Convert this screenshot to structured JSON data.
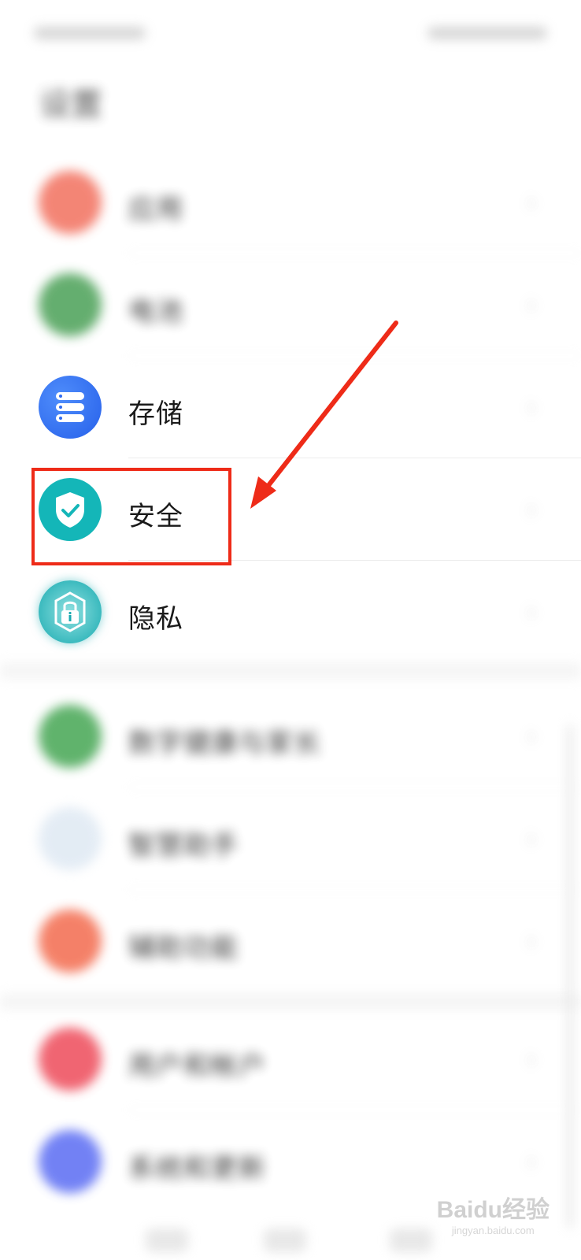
{
  "status_bar": {
    "left_text": "",
    "right_text": ""
  },
  "page": {
    "title": "设置"
  },
  "settings_items": [
    {
      "label": "应用",
      "icon": "apps-icon",
      "color": "#f2705e",
      "blurred": true
    },
    {
      "label": "电池",
      "icon": "battery-icon",
      "color": "#4aa056",
      "blurred": true
    },
    {
      "label": "存储",
      "icon": "storage-icon",
      "color": "#2f6bf0",
      "blurred": false
    },
    {
      "label": "安全",
      "icon": "shield-check-icon",
      "color": "#14b6b8",
      "blurred": false
    },
    {
      "label": "隐私",
      "icon": "lock-info-icon",
      "color": "#1fb3b5",
      "blurred": false
    },
    {
      "label": "数字健康与家长",
      "icon": "hourglass-icon",
      "color": "#45a653",
      "blurred": true
    },
    {
      "label": "智慧助手",
      "icon": "assistant-icon",
      "color": "#9cc0e0",
      "blurred": true
    },
    {
      "label": "辅助功能",
      "icon": "accessibility-icon",
      "color": "#f36b4e",
      "blurred": true
    },
    {
      "label": "用户和帐户",
      "icon": "user-icon",
      "color": "#ee4b5a",
      "blurred": true
    },
    {
      "label": "系统和更新",
      "icon": "system-icon",
      "color": "#5a6cf3",
      "blurred": true
    }
  ],
  "annotation": {
    "color": "#ee2b18"
  },
  "watermark": {
    "brand": "Bai",
    "brand_mid": "du",
    "brand_tail": "经验",
    "url": "jingyan.baidu.com"
  }
}
